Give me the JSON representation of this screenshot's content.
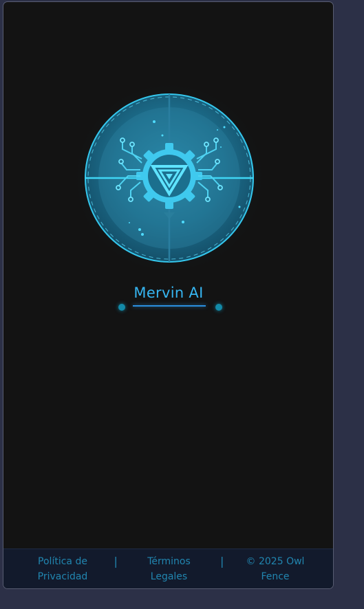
{
  "brand": {
    "title": "Mervin AI",
    "accent_color": "#36b6f2",
    "logo_icon": "circuit-gear-triangle-emblem"
  },
  "footer": {
    "links": [
      {
        "line1": "Política de",
        "line2": "Privacidad"
      },
      {
        "line1": "Términos",
        "line2": "Legales"
      },
      {
        "line1": "© 2025 Owl",
        "line2": "Fence"
      }
    ],
    "separator": "|",
    "link_color": "#2186b0"
  },
  "colors": {
    "page_background": "#2c3047",
    "panel_background": "#131313",
    "footer_background": "#121a2c"
  }
}
